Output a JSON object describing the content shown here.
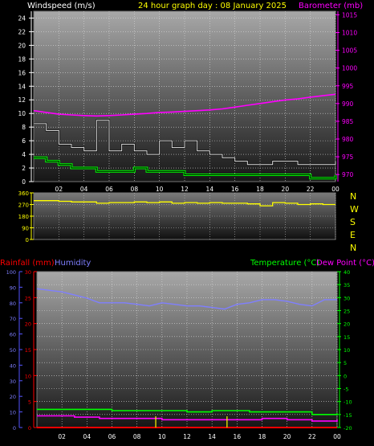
{
  "header": {
    "wind_label": "Windspeed (m/s)",
    "title": "24 hour graph day : 08 January 2025",
    "baro_label": "Barometer (mb)"
  },
  "lower_header": {
    "rain_label": "Rainfall (mm)",
    "humidity_label": "Humidity",
    "temp_label": "Temperature (°C)",
    "dew_label": "Dew Point (°C)"
  },
  "colors": {
    "wind_text": "#ffffff",
    "title_text": "#ffff00",
    "baro": "#ff00ff",
    "wind_gust": "#e8e8e8",
    "wind_avg": "#000000",
    "wind_avg_fill": "#00ff00",
    "direction": "#ffff00",
    "rain": "#ff0000",
    "humidity": "#7f7fff",
    "temperature": "#00ff00",
    "dewpoint": "#ff00ff",
    "axis_blue": "#5555ff",
    "axis_red": "#ff0000",
    "axis_green": "#00ff00"
  },
  "x_ticks": [
    "02",
    "04",
    "06",
    "08",
    "10",
    "12",
    "14",
    "16",
    "18",
    "20",
    "22",
    "00"
  ],
  "wind_ticks": [
    "0",
    "2",
    "4",
    "6",
    "8",
    "10",
    "12",
    "14",
    "16",
    "18",
    "20",
    "22",
    "24"
  ],
  "baro_ticks": [
    "970",
    "975",
    "980",
    "985",
    "990",
    "995",
    "1000",
    "1005",
    "1010",
    "1015"
  ],
  "dir_ticks": [
    "0",
    "90",
    "180",
    "270",
    "360"
  ],
  "compass": [
    "N",
    "W",
    "S",
    "E",
    "N"
  ],
  "hum_ticks": [
    "0",
    "10",
    "20",
    "30",
    "40",
    "50",
    "60",
    "70",
    "80",
    "90",
    "100"
  ],
  "rain_ticks": [
    "0",
    "5",
    "10",
    "15",
    "20",
    "25",
    "30"
  ],
  "temp_ticks": [
    "-20",
    "-15",
    "-10",
    "-5",
    "0",
    "5",
    "10",
    "15",
    "20",
    "25",
    "30",
    "35",
    "40"
  ],
  "chart_data": [
    {
      "type": "line",
      "panel": "wind_baro",
      "xlabel": "",
      "x_hours": [
        0,
        1,
        2,
        3,
        4,
        5,
        6,
        7,
        8,
        9,
        10,
        11,
        12,
        13,
        14,
        15,
        16,
        17,
        18,
        19,
        20,
        21,
        22,
        23,
        24
      ],
      "y_left_label": "Windspeed (m/s)",
      "y_left_range": [
        0,
        25
      ],
      "y_right_label": "Barometer (mb)",
      "y_right_range": [
        968,
        1016
      ],
      "series": [
        {
          "name": "Gust",
          "axis": "left",
          "values": [
            8.5,
            7.5,
            5.5,
            5,
            4.5,
            9,
            4.5,
            5.5,
            4.5,
            4,
            6,
            5,
            6,
            4.5,
            4,
            3.5,
            3,
            2.5,
            2.5,
            3,
            3,
            2.5,
            2.5,
            2.5,
            3
          ]
        },
        {
          "name": "Wind Speed",
          "axis": "left",
          "values": [
            3.5,
            3,
            2.5,
            2,
            2,
            1.5,
            1.5,
            1.5,
            2,
            1.5,
            1.5,
            1.5,
            1,
            1,
            1,
            1,
            1,
            1,
            1,
            1,
            1,
            1,
            0.5,
            0.5,
            1
          ]
        },
        {
          "name": "Barometer",
          "axis": "right",
          "values": [
            988,
            987.5,
            987,
            986.8,
            986.6,
            986.5,
            986.6,
            986.8,
            987,
            987.2,
            987.5,
            987.6,
            987.8,
            988,
            988.2,
            988.5,
            989,
            989.5,
            990,
            990.5,
            991,
            991.3,
            991.8,
            992.2,
            992.6
          ]
        }
      ]
    },
    {
      "type": "line",
      "panel": "wind_direction",
      "y_range": [
        0,
        360
      ],
      "series": [
        {
          "name": "Wind Direction",
          "values": [
            300,
            300,
            295,
            290,
            290,
            280,
            285,
            285,
            290,
            285,
            290,
            280,
            285,
            280,
            285,
            280,
            280,
            275,
            260,
            285,
            280,
            270,
            275,
            270,
            270
          ]
        }
      ]
    },
    {
      "type": "line",
      "panel": "temp_hum_rain",
      "y_left_label": "Humidity",
      "y_left_range": [
        0,
        100
      ],
      "rain_range": [
        0,
        30
      ],
      "y_right_label": "Temperature (°C)",
      "y_right_range": [
        -20,
        40
      ],
      "series": [
        {
          "name": "Humidity",
          "axis": "left",
          "values": [
            89,
            88,
            87,
            85,
            83,
            80,
            80,
            80,
            79,
            78,
            80,
            79,
            78,
            78,
            77,
            76,
            79,
            80,
            82,
            82,
            81,
            79,
            78,
            82,
            82
          ]
        },
        {
          "name": "Temperature",
          "axis": "right",
          "values": [
            -13,
            -13,
            -13,
            -13,
            -13,
            -13,
            -13.5,
            -13.5,
            -13.5,
            -13.5,
            -13.5,
            -13.5,
            -14,
            -14,
            -13.5,
            -13.5,
            -13.5,
            -14,
            -14,
            -14,
            -14,
            -14,
            -15,
            -15,
            -14.5
          ]
        },
        {
          "name": "Dew Point",
          "axis": "right",
          "values": [
            -15.5,
            -15.5,
            -15.5,
            -16,
            -16,
            -16.5,
            -16.5,
            -16.5,
            -16.5,
            -16.5,
            -17,
            -17,
            -17,
            -17,
            -17,
            -17,
            -17,
            -17,
            -16.5,
            -16.5,
            -17,
            -17,
            -17.5,
            -17.5,
            -17
          ]
        },
        {
          "name": "Rainfall",
          "axis": "rain",
          "values": [
            0,
            0,
            0,
            0,
            0,
            0,
            0,
            0,
            0,
            0,
            0,
            0,
            0,
            0,
            0,
            0,
            0,
            0,
            0,
            0,
            0,
            0,
            0,
            0,
            0
          ]
        }
      ]
    }
  ]
}
